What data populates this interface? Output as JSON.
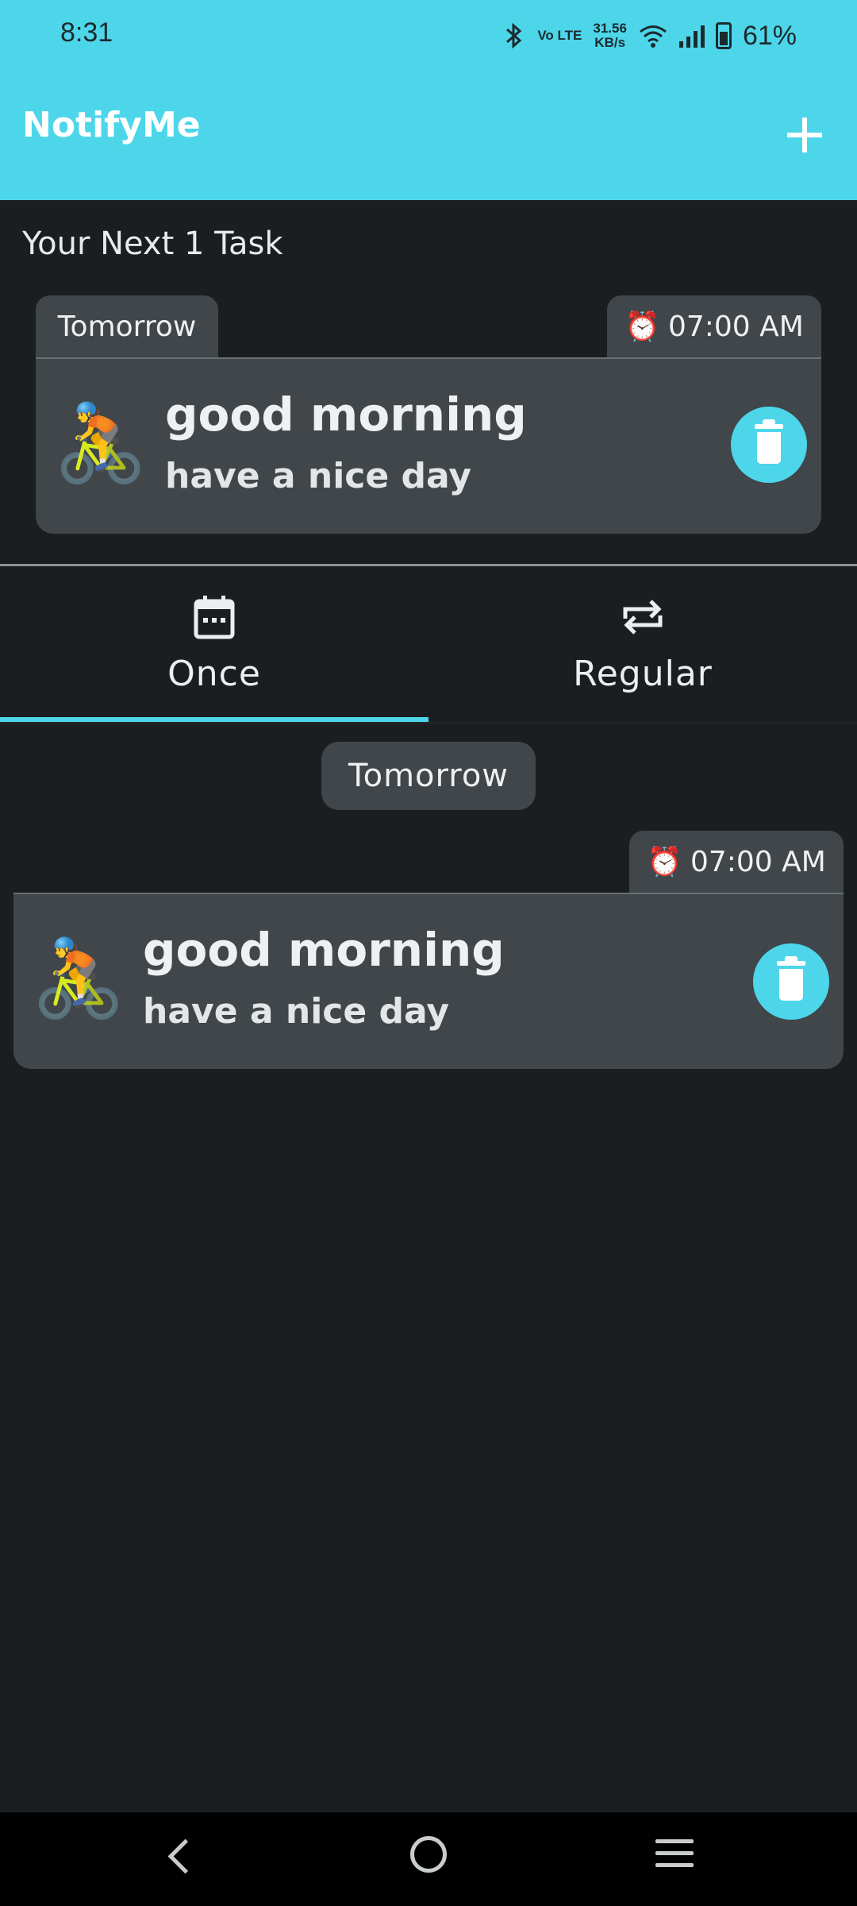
{
  "status_bar": {
    "time": "8:31",
    "volte": "Vo LTE",
    "speed_value": "31.56",
    "speed_unit": "KB/s",
    "battery": "61%"
  },
  "app_bar": {
    "title": "NotifyMe",
    "add_icon": "plus-icon"
  },
  "summary": {
    "title": "Your Next 1 Task",
    "card": {
      "day": "Tomorrow",
      "time": "07:00 AM",
      "emoji": "🚴",
      "title": "good morning",
      "description": "have a nice day"
    }
  },
  "tabs": [
    {
      "label": "Once",
      "icon": "calendar-icon",
      "selected": true
    },
    {
      "label": "Regular",
      "icon": "repeat-icon",
      "selected": false
    }
  ],
  "list": {
    "date_chip": "Tomorrow",
    "items": [
      {
        "time": "07:00 AM",
        "emoji": "🚴",
        "title": "good morning",
        "description": "have a nice day"
      }
    ]
  },
  "colors": {
    "accent": "#4dd6ea",
    "background": "#1b1e20",
    "card": "#40464a"
  }
}
